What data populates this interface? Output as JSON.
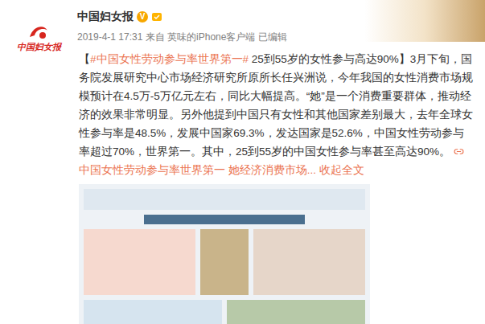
{
  "post": {
    "avatar_text": "中国妇女报",
    "user_name": "中国妇女报",
    "verified_mark": "V",
    "meta": "2019-4-1 17:31 来自 英味的iPhone客户端  已编辑",
    "body": [
      {
        "text": "【",
        "kind": "plain",
        "icon": false
      },
      {
        "text": "#中国女性劳动参与率世界第一#",
        "kind": "link",
        "icon": false
      },
      {
        "text": " 25到55岁的女性参与高达90%】3月下旬，国务院发展研究中心市场经济研究所原所长任兴洲说，今年我国的女性消费市场规模预计在4.5万-5万亿元左右，同比大幅提高。“她”是一个消费重要群体，推动经济的效果非常明显。另外他提到中国只有女性和其他国家差别最大，去年全球女性参与率是48.5%，发展中国家69.3%，发达国家是52.6%，中国女性劳动参与率超过70%，世界第一。其中，25到55岁的中国女性参与率甚至高达90%。 ",
        "kind": "plain",
        "icon": false
      },
      {
        "text": "中国女性劳动参与率世界第一 她经济消费市场...",
        "kind": "link",
        "icon": true
      },
      {
        "text": " 收起全文",
        "kind": "link",
        "icon": false
      }
    ]
  }
}
